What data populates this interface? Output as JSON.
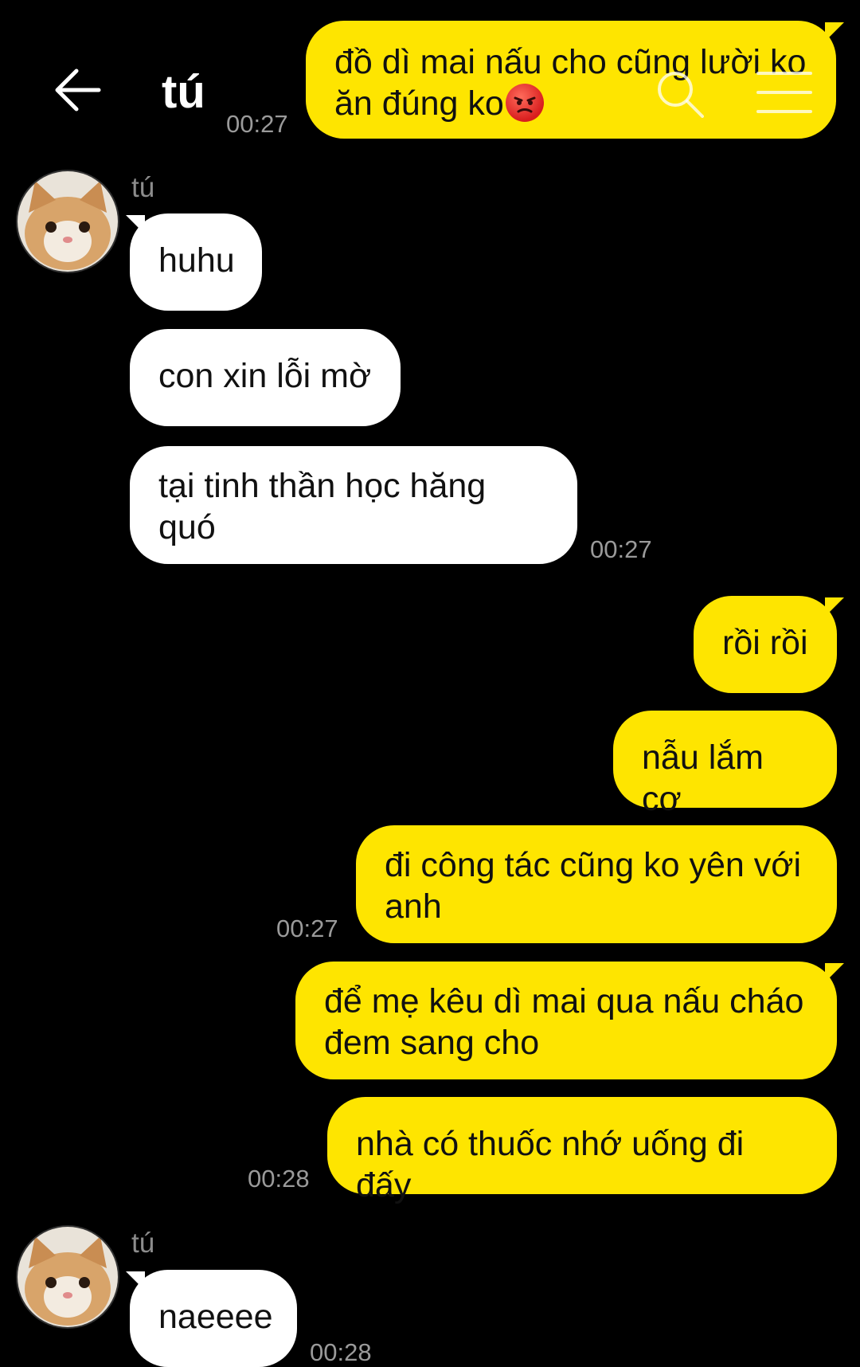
{
  "header": {
    "title": "tú"
  },
  "contact_name": "tú",
  "messages": {
    "m1_line1": "đồ dì mai nấu cho cũng lười ko",
    "m1_line2": "ăn đúng ko",
    "m1_emoji": "angry-face-emoji",
    "m1_time": "00:27",
    "t1": "huhu",
    "t2": "con xin lỗi mờ",
    "t3_line1": "tại tinh thần học hăng",
    "t3_line2": "quó",
    "t3_time": "00:27",
    "m2": "rồi rồi",
    "m3": "nẫu lắm cơ",
    "m4_line1": "đi công tác cũng ko yên với",
    "m4_line2": "anh",
    "m4_time": "00:27",
    "m5_line1": "để mẹ kêu dì mai qua nấu cháo",
    "m5_line2": "đem sang cho",
    "m6": "nhà có thuốc nhớ uống đi đấy",
    "m6_time": "00:28",
    "t4": "naeeee",
    "t4_time": "00:28"
  },
  "icons": {
    "back": "back-arrow-icon",
    "search": "search-icon",
    "menu": "menu-icon",
    "avatar": "cat-avatar"
  },
  "colors": {
    "background": "#000000",
    "my_bubble": "#FEE500",
    "their_bubble": "#FFFFFF",
    "timestamp": "#9A9A9A"
  }
}
